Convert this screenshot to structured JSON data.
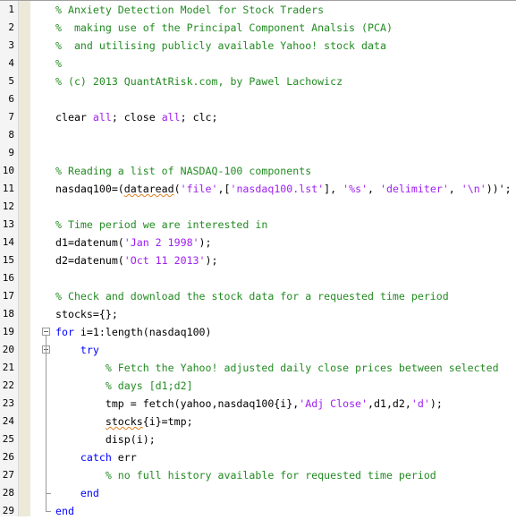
{
  "editor": {
    "colors": {
      "comment": "#228b22",
      "keyword": "#0000ff",
      "string": "#a020f0",
      "text": "#000000"
    },
    "lines": [
      {
        "n": "1",
        "seg": [
          [
            "c",
            "% Anxiety Detection Model for Stock Traders"
          ]
        ]
      },
      {
        "n": "2",
        "seg": [
          [
            "c",
            "%  making use of the Principal Component Analsis (PCA)"
          ]
        ]
      },
      {
        "n": "3",
        "seg": [
          [
            "c",
            "%  and utilising publicly available Yahoo! stock data"
          ]
        ]
      },
      {
        "n": "4",
        "seg": [
          [
            "c",
            "%"
          ]
        ]
      },
      {
        "n": "5",
        "seg": [
          [
            "c",
            "% (c) 2013 QuantAtRisk.com, by Pawel Lachowicz"
          ]
        ]
      },
      {
        "n": "6",
        "seg": []
      },
      {
        "n": "7",
        "seg": [
          [
            "p",
            "clear "
          ],
          [
            "s",
            "all"
          ],
          [
            "p",
            "; close "
          ],
          [
            "s",
            "all"
          ],
          [
            "p",
            "; clc;"
          ]
        ]
      },
      {
        "n": "8",
        "seg": []
      },
      {
        "n": "9",
        "seg": []
      },
      {
        "n": "10",
        "seg": [
          [
            "c",
            "% Reading a list of NASDAQ-100 components"
          ]
        ]
      },
      {
        "n": "11",
        "seg": [
          [
            "p",
            "nasdaq100=("
          ],
          [
            "w",
            "dataread"
          ],
          [
            "p",
            "("
          ],
          [
            "s",
            "'file'"
          ],
          [
            "p",
            ",["
          ],
          [
            "s",
            "'nasdaq100.lst'"
          ],
          [
            "p",
            "], "
          ],
          [
            "s",
            "'%s'"
          ],
          [
            "p",
            ", "
          ],
          [
            "s",
            "'delimiter'"
          ],
          [
            "p",
            ", "
          ],
          [
            "s",
            "'\\n'"
          ],
          [
            "p",
            "))';"
          ]
        ]
      },
      {
        "n": "12",
        "seg": []
      },
      {
        "n": "13",
        "seg": [
          [
            "c",
            "% Time period we are interested in"
          ]
        ]
      },
      {
        "n": "14",
        "seg": [
          [
            "p",
            "d1=datenum("
          ],
          [
            "s",
            "'Jan 2 1998'"
          ],
          [
            "p",
            ");"
          ]
        ]
      },
      {
        "n": "15",
        "seg": [
          [
            "p",
            "d2=datenum("
          ],
          [
            "s",
            "'Oct 11 2013'"
          ],
          [
            "p",
            ");"
          ]
        ]
      },
      {
        "n": "16",
        "seg": []
      },
      {
        "n": "17",
        "seg": [
          [
            "c",
            "% Check and download the stock data for a requested time period"
          ]
        ]
      },
      {
        "n": "18",
        "seg": [
          [
            "p",
            "stocks={};"
          ]
        ]
      },
      {
        "n": "19",
        "seg": [
          [
            "k",
            "for"
          ],
          [
            "p",
            " i=1:length(nasdaq100)"
          ]
        ]
      },
      {
        "n": "20",
        "seg": [
          [
            "p",
            "    "
          ],
          [
            "k",
            "try"
          ]
        ]
      },
      {
        "n": "21",
        "seg": [
          [
            "p",
            "        "
          ],
          [
            "c",
            "% Fetch the Yahoo! adjusted daily close prices between selected"
          ]
        ]
      },
      {
        "n": "22",
        "seg": [
          [
            "p",
            "        "
          ],
          [
            "c",
            "% days [d1;d2]"
          ]
        ]
      },
      {
        "n": "23",
        "seg": [
          [
            "p",
            "        tmp = fetch(yahoo,nasdaq100{i},"
          ],
          [
            "s",
            "'Adj Close'"
          ],
          [
            "p",
            ",d1,d2,"
          ],
          [
            "s",
            "'d'"
          ],
          [
            "p",
            ");"
          ]
        ]
      },
      {
        "n": "24",
        "seg": [
          [
            "p",
            "        "
          ],
          [
            "w",
            "stocks"
          ],
          [
            "p",
            "{i}=tmp;"
          ]
        ]
      },
      {
        "n": "25",
        "seg": [
          [
            "p",
            "        disp(i);"
          ]
        ]
      },
      {
        "n": "26",
        "seg": [
          [
            "p",
            "    "
          ],
          [
            "k",
            "catch"
          ],
          [
            "p",
            " err"
          ]
        ]
      },
      {
        "n": "27",
        "seg": [
          [
            "p",
            "        "
          ],
          [
            "c",
            "% no full history available for requested time period"
          ]
        ]
      },
      {
        "n": "28",
        "seg": [
          [
            "p",
            "    "
          ],
          [
            "k",
            "end"
          ]
        ]
      },
      {
        "n": "29",
        "seg": [
          [
            "k",
            "end"
          ]
        ]
      }
    ]
  }
}
